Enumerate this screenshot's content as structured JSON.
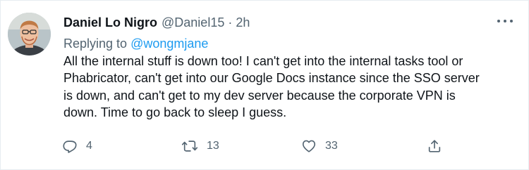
{
  "tweet": {
    "author": {
      "display_name": "Daniel Lo Nigro",
      "handle": "@Daniel15",
      "separator": "·",
      "time": "2h"
    },
    "reply": {
      "prefix": "Replying to",
      "mention": "@wongmjane"
    },
    "text_lines": [
      "All the internal stuff is down too! I can't get into the internal tasks tool or",
      "Phabricator, can't get into our Google Docs instance since the SSO server",
      "is down, and can't get to my dev server because the corporate VPN is",
      "down. Time to go back to sleep I guess."
    ],
    "actions": {
      "reply": {
        "icon": "reply-icon",
        "count": "4"
      },
      "retweet": {
        "icon": "retweet-icon",
        "count": "13"
      },
      "like": {
        "icon": "heart-icon",
        "count": "33"
      },
      "share": {
        "icon": "share-icon"
      }
    }
  },
  "colors": {
    "text": "#0f1419",
    "secondary": "#536471",
    "link": "#1d9bf0",
    "border": "#e6ecf0"
  }
}
